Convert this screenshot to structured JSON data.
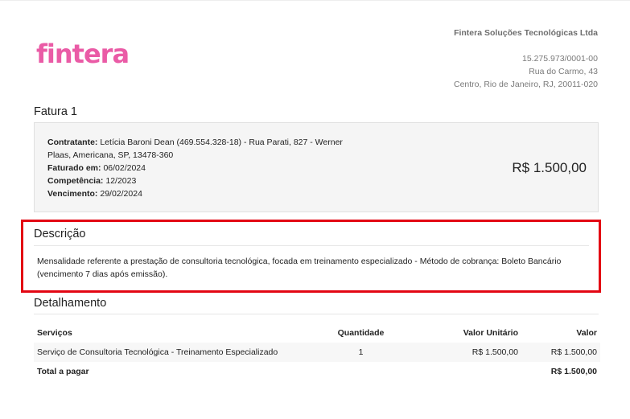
{
  "brand": {
    "logo_text": "fintera",
    "logo_color": "#ea5ba6"
  },
  "company": {
    "name": "Fintera Soluções Tecnológicas Ltda",
    "cnpj": "15.275.973/0001-00",
    "address_line1": "Rua do Carmo, 43",
    "address_line2": "Centro, Rio de Janeiro, RJ, 20011-020"
  },
  "invoice": {
    "title": "Fatura 1",
    "contratante_label": "Contratante:",
    "contratante_value": "Letícia Baroni Dean (469.554.328-18) - Rua Parati, 827 - Werner Plaas, Americana, SP, 13478-360",
    "faturado_label": "Faturado em:",
    "faturado_value": "06/02/2024",
    "competencia_label": "Competência:",
    "competencia_value": "12/2023",
    "vencimento_label": "Vencimento:",
    "vencimento_value": "29/02/2024",
    "amount": "R$ 1.500,00"
  },
  "description": {
    "title": "Descrição",
    "text": "Mensalidade referente a prestação de consultoria tecnológica, focada em treinamento especializado - Método de cobrança: Boleto Bancário (vencimento 7 dias após emissão).",
    "highlight_color": "#e30613"
  },
  "details": {
    "title": "Detalhamento",
    "columns": {
      "service": "Serviços",
      "quantity": "Quantidade",
      "unit_value": "Valor Unitário",
      "value": "Valor"
    },
    "items": [
      {
        "service": "Serviço de Consultoria Tecnológica - Treinamento Especializado",
        "quantity": "1",
        "unit_value": "R$ 1.500,00",
        "value": "R$ 1.500,00"
      }
    ],
    "total_label": "Total a pagar",
    "total_value": "R$ 1.500,00"
  }
}
